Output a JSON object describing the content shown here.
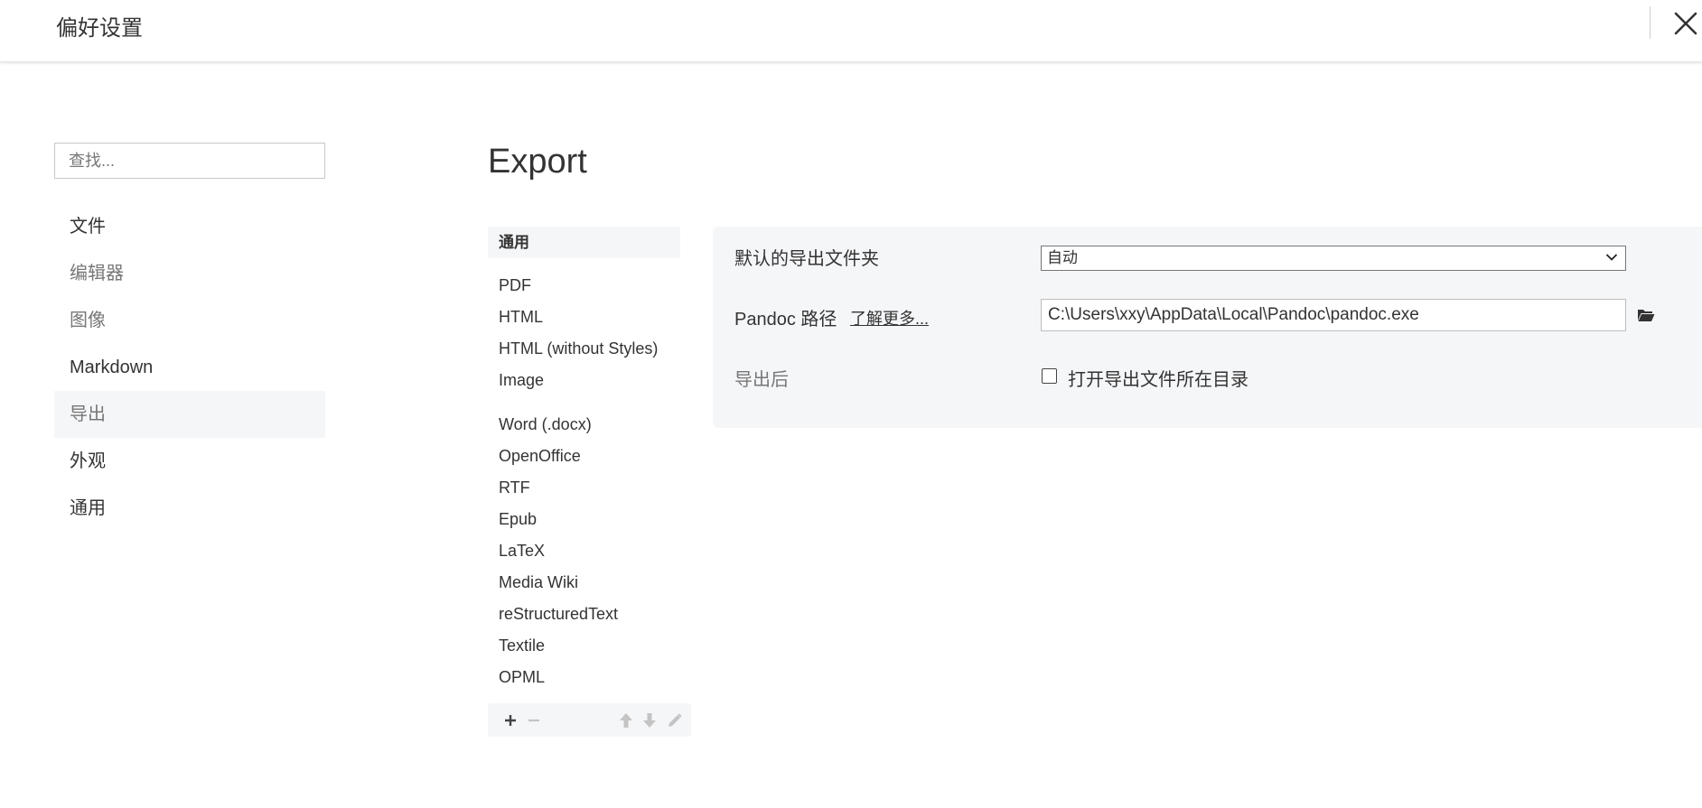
{
  "header": {
    "title": "偏好设置",
    "close_icon": "close-icon"
  },
  "sidebar": {
    "search_placeholder": "查找...",
    "items": [
      {
        "label": "文件"
      },
      {
        "label": "编辑器"
      },
      {
        "label": "图像"
      },
      {
        "label": "Markdown"
      },
      {
        "label": "导出",
        "active": true
      },
      {
        "label": "外观"
      },
      {
        "label": "通用"
      }
    ]
  },
  "main": {
    "heading": "Export",
    "formats": {
      "active": "通用",
      "group1": [
        "PDF",
        "HTML",
        "HTML (without Styles)",
        "Image"
      ],
      "group2": [
        "Word (.docx)",
        "OpenOffice",
        "RTF",
        "Epub",
        "LaTeX",
        "Media Wiki",
        "reStructuredText",
        "Textile",
        "OPML"
      ]
    },
    "toolbar": {
      "add_icon": "plus-icon",
      "remove_icon": "minus-icon",
      "up_icon": "arrow-up-icon",
      "down_icon": "arrow-down-icon",
      "edit_icon": "pencil-icon"
    },
    "settings": {
      "default_folder_label": "默认的导出文件夹",
      "default_folder_value": "自动",
      "pandoc_label": "Pandoc 路径",
      "learn_more": "了解更多...",
      "pandoc_path": "C:\\Users\\xxy\\AppData\\Local\\Pandoc\\pandoc.exe",
      "folder_icon": "folder-icon",
      "after_export_label": "导出后",
      "open_folder_label": "打开导出文件所在目录",
      "open_folder_checked": false
    }
  }
}
